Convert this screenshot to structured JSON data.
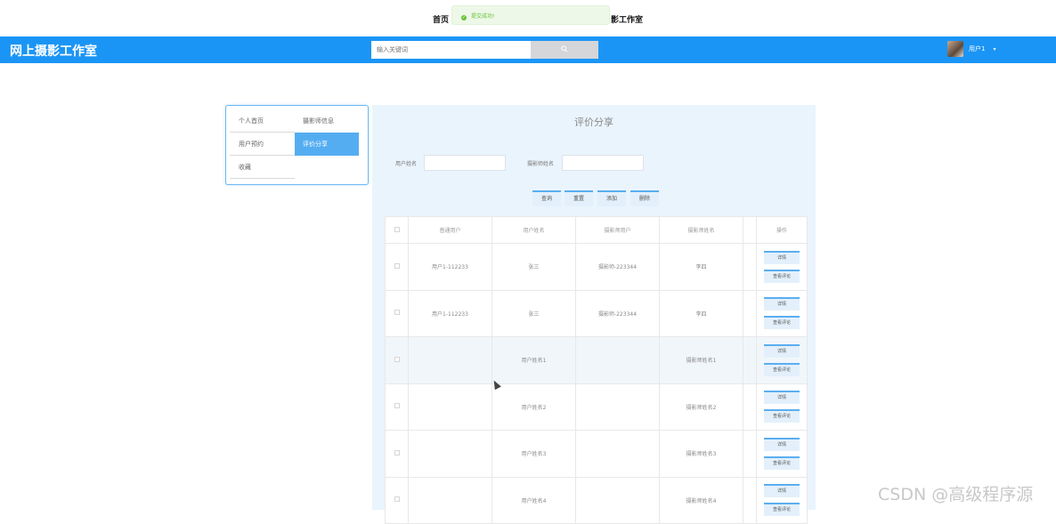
{
  "topnav": {
    "home": "首页",
    "studio_fragment": "影工作室"
  },
  "toast": {
    "message": "提交成功!"
  },
  "header": {
    "brand": "网上摄影工作室",
    "search_placeholder": "输入关键词",
    "search_icon": "search-icon",
    "user_name": "用户1",
    "caret": "▾"
  },
  "sidebar": {
    "items": [
      {
        "label": "个人首页"
      },
      {
        "label": "摄影师信息"
      },
      {
        "label": "用户预约"
      },
      {
        "label": "评价分享",
        "active": true
      },
      {
        "label": "收藏"
      }
    ]
  },
  "panel": {
    "title": "评价分享",
    "filters": [
      {
        "label": "用户姓名"
      },
      {
        "label": "摄影师姓名"
      }
    ],
    "buttons": [
      "查询",
      "重置",
      "添加",
      "删除"
    ]
  },
  "table": {
    "headers": [
      "",
      "普通用户",
      "用户姓名",
      "摄影师用户",
      "摄影师姓名",
      "",
      "操作"
    ],
    "row_actions": [
      "详情",
      "查看评论"
    ],
    "rows": [
      [
        "用户1-112233",
        "张三",
        "摄影师-223344",
        "李四"
      ],
      [
        "用户1-112233",
        "张三",
        "摄影师-223344",
        "李四"
      ],
      [
        "",
        "用户姓名1",
        "",
        "摄影师姓名1"
      ],
      [
        "",
        "用户姓名2",
        "",
        "摄影师姓名2"
      ],
      [
        "",
        "用户姓名3",
        "",
        "摄影师姓名3"
      ],
      [
        "",
        "用户姓名4",
        "",
        "摄影师姓名4"
      ]
    ]
  },
  "watermark": "CSDN @高级程序源",
  "colors": {
    "brand": "#1b95f5",
    "active": "#55adf1",
    "panel": "#eaf4fd",
    "success": "#67c23a"
  }
}
